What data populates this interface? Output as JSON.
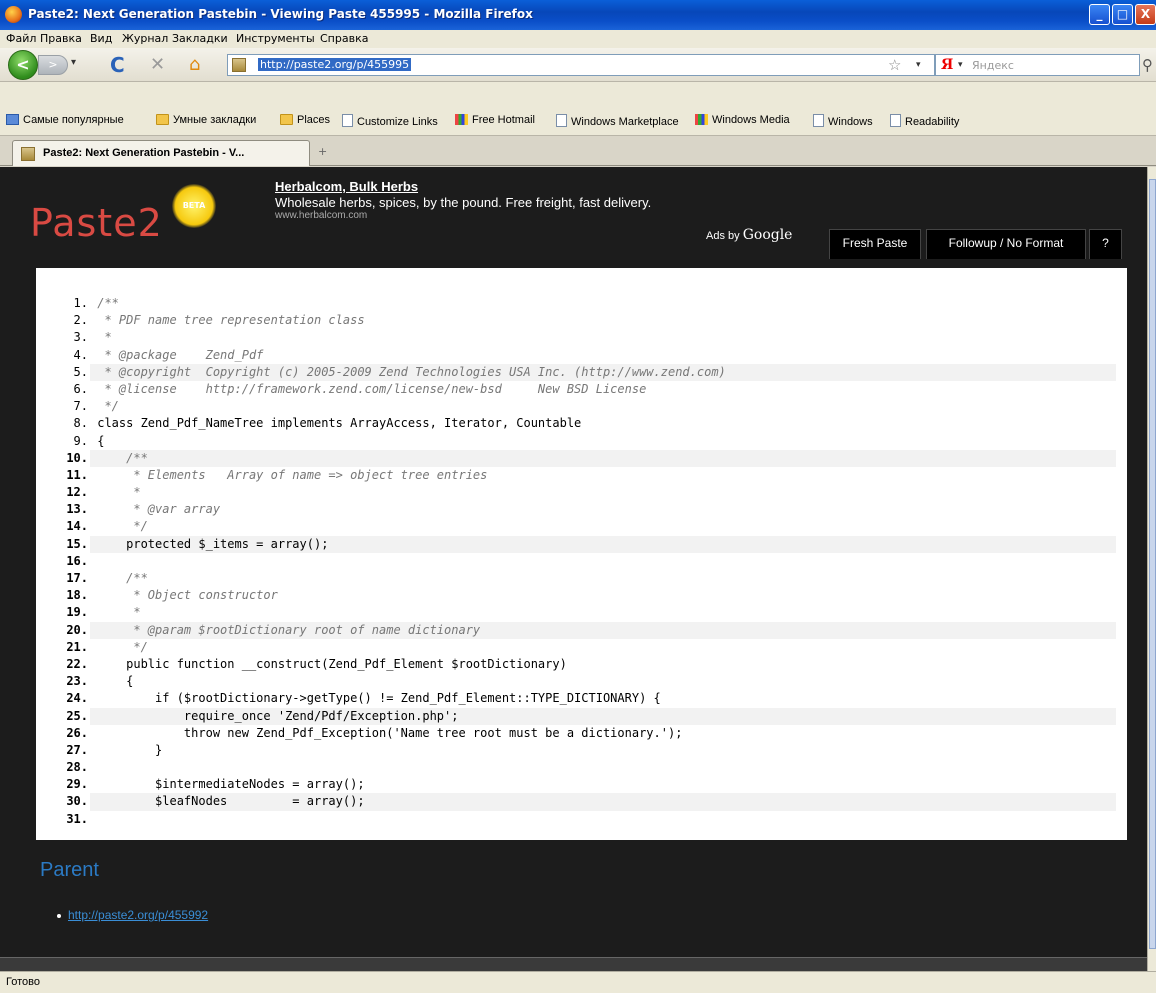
{
  "window": {
    "title": "Paste2: Next Generation Pastebin - Viewing Paste 455995 - Mozilla Firefox",
    "minimize": "_",
    "maximize": "□",
    "close": "X"
  },
  "menu": [
    "Файл",
    "Правка",
    "Вид",
    "Журнал",
    "Закладки",
    "Инструменты",
    "Справка"
  ],
  "nav": {
    "back": "<",
    "forward": ">",
    "history_dropdown": "▾",
    "reload": "C",
    "stop": "✕",
    "home": "⌂",
    "url": "http://paste2.org/p/455995",
    "star": "☆",
    "url_dropdown": "▾",
    "search_engine": "Я",
    "search_dropdown": "▾",
    "search_placeholder": "Яндекс",
    "search_go": "⚲"
  },
  "bookmarks": [
    {
      "label": "Самые популярные",
      "icon": "bookmarks-star-icon"
    },
    {
      "label": "Умные закладки",
      "icon": "folder-icon"
    },
    {
      "label": "Places",
      "icon": "folder-icon"
    },
    {
      "label": "Customize Links",
      "icon": "page-icon"
    },
    {
      "label": "Free Hotmail",
      "icon": "windows-logo-icon"
    },
    {
      "label": "Windows Marketplace",
      "icon": "page-icon"
    },
    {
      "label": "Windows Media",
      "icon": "windows-logo-icon"
    },
    {
      "label": "Windows",
      "icon": "page-icon"
    },
    {
      "label": "Readability",
      "icon": "page-icon"
    }
  ],
  "tabs": [
    {
      "label": "Paste2: Next Generation Pastebin - V...",
      "close": "×"
    }
  ],
  "new_tab": "+",
  "page": {
    "logo": "Paste2",
    "beta": "BETA",
    "ad": {
      "title": "Herbalcom, Bulk Herbs",
      "description": "Wholesale herbs, spices, by the pound. Free freight, fast delivery.",
      "url": "www.herbalcom.com"
    },
    "ads_by": "Ads by",
    "ads_google": "Google",
    "page_tabs": [
      "Fresh Paste",
      "Followup / No Format",
      "?"
    ],
    "code": [
      {
        "n": "1.",
        "t": "/**"
      },
      {
        "n": "2.",
        "t": " * PDF name tree representation class"
      },
      {
        "n": "3.",
        "t": " *"
      },
      {
        "n": "4.",
        "t": " * @package    Zend_Pdf"
      },
      {
        "n": "5.",
        "t": " * @copyright  Copyright (c) 2005-2009 Zend Technologies USA Inc. (http://www.zend.com)"
      },
      {
        "n": "6.",
        "t": " * @license    http://framework.zend.com/license/new-bsd     New BSD License"
      },
      {
        "n": "7.",
        "t": " */"
      },
      {
        "n": "8.",
        "t": "class Zend_Pdf_NameTree implements ArrayAccess, Iterator, Countable"
      },
      {
        "n": "9.",
        "t": "{"
      },
      {
        "n": "10.",
        "t": "    /**"
      },
      {
        "n": "11.",
        "t": "     * Elements   Array of name => object tree entries"
      },
      {
        "n": "12.",
        "t": "     *"
      },
      {
        "n": "13.",
        "t": "     * @var array"
      },
      {
        "n": "14.",
        "t": "     */"
      },
      {
        "n": "15.",
        "t": "    protected $_items = array();"
      },
      {
        "n": "16.",
        "t": ""
      },
      {
        "n": "17.",
        "t": "    /**"
      },
      {
        "n": "18.",
        "t": "     * Object constructor"
      },
      {
        "n": "19.",
        "t": "     *"
      },
      {
        "n": "20.",
        "t": "     * @param $rootDictionary root of name dictionary"
      },
      {
        "n": "21.",
        "t": "     */"
      },
      {
        "n": "22.",
        "t": "    public function __construct(Zend_Pdf_Element $rootDictionary)"
      },
      {
        "n": "23.",
        "t": "    {"
      },
      {
        "n": "24.",
        "t": "        if ($rootDictionary->getType() != Zend_Pdf_Element::TYPE_DICTIONARY) {"
      },
      {
        "n": "25.",
        "t": "            require_once 'Zend/Pdf/Exception.php';"
      },
      {
        "n": "26.",
        "t": "            throw new Zend_Pdf_Exception('Name tree root must be a dictionary.');"
      },
      {
        "n": "27.",
        "t": "        }"
      },
      {
        "n": "28.",
        "t": ""
      },
      {
        "n": "29.",
        "t": "        $intermediateNodes = array();"
      },
      {
        "n": "30.",
        "t": "        $leafNodes         = array();"
      },
      {
        "n": "31.",
        "t": ""
      }
    ],
    "parent_title": "Parent",
    "parent_link": "http://paste2.org/p/455992"
  },
  "status": "Готово"
}
